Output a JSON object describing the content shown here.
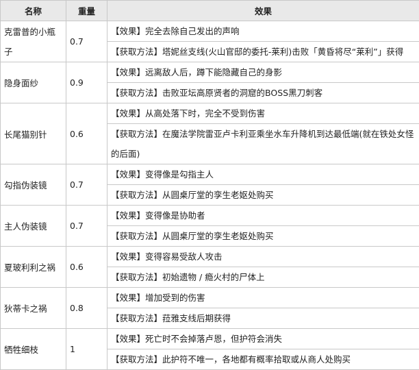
{
  "headers": {
    "name": "名称",
    "weight": "重量",
    "effect": "效果"
  },
  "rows": [
    {
      "name": "克雷普的小瓶子",
      "weight": "0.7",
      "effect": "【效果】完全去除自己发出的声响",
      "obtain": "【获取方法】塔妮丝支线(火山官邸的委托-莱利)击败「黄昏将尽“莱利”」获得"
    },
    {
      "name": "隐身面纱",
      "weight": "0.9",
      "effect": "【效果】远离敌人后，蹲下能隐藏自己的身影",
      "obtain": "【获取方法】击败亚坛高原贤者的洞窟的BOSS黑刀刺客"
    },
    {
      "name": "长尾猫别针",
      "weight": "0.6",
      "effect": "【效果】从高处落下时，完全不受到伤害",
      "obtain": "【获取方法】在魔法学院雷亚卢卡利亚乘坐水车升降机到达最低端(就在铁处女怪的后面)"
    },
    {
      "name": "勾指伪装镜",
      "weight": "0.7",
      "effect": "【效果】变得像是勾指主人",
      "obtain": "【获取方法】从圆桌厅堂的孪生老妪处购买"
    },
    {
      "name": "主人伪装镜",
      "weight": "0.7",
      "effect": "【效果】变得像是协助者",
      "obtain": "【获取方法】从圆桌厅堂的孪生老妪处购买"
    },
    {
      "name": "夏玻利利之祸",
      "weight": "0.6",
      "effect": "【效果】变得容易受敌人攻击",
      "obtain": "【获取方法】初始遗物 / 瘾火村的尸体上"
    },
    {
      "name": "狄蒂卡之祸",
      "weight": "0.8",
      "effect": "【效果】增加受到的伤害",
      "obtain": "【获取方法】菈雅支线后期获得"
    },
    {
      "name": "牺牲细枝",
      "weight": "1",
      "effect": "【效果】死亡时不会掉落卢恩，但护符会消失",
      "obtain": "【获取方法】此护符不唯一，各地都有概率拾取或从商人处购买"
    }
  ]
}
